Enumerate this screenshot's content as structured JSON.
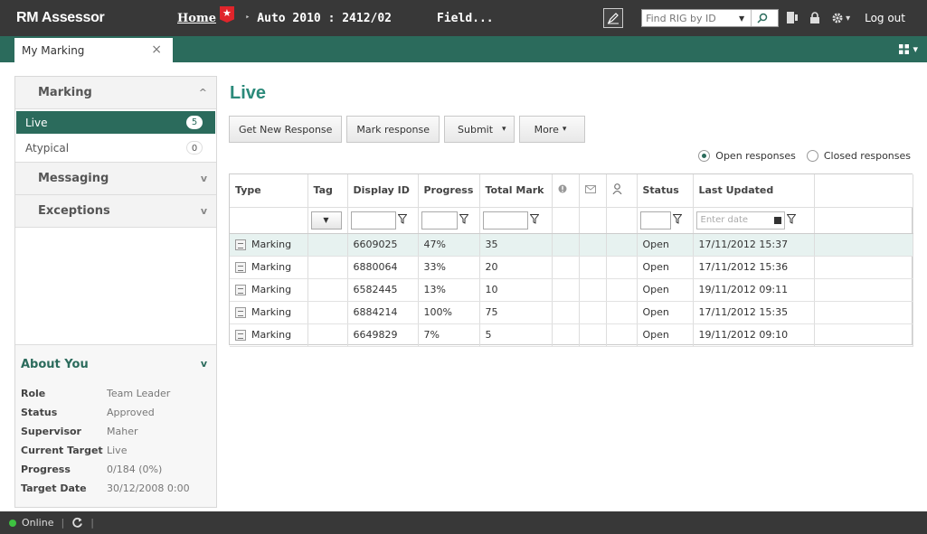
{
  "topbar": {
    "logo": "RM Assessor",
    "home_label": "Home",
    "home_badge": "★",
    "crumb_arrow": "‣",
    "crumb1": "Auto 2010 : 2412/02",
    "crumb2": "Field...",
    "find_placeholder": "Find RIG by ID",
    "find_dropdown": "▼",
    "settings_caret": "▾",
    "logout_label": "Log out"
  },
  "tabs": [
    {
      "label": "My Marking",
      "close": "×"
    }
  ],
  "grid_menu": {
    "caret": "▾"
  },
  "sidebar": {
    "marking": {
      "title": "Marking",
      "chevron": "^"
    },
    "items": [
      {
        "label": "Live",
        "count": "5"
      },
      {
        "label": "Atypical",
        "count": "0"
      }
    ],
    "messaging": {
      "title": "Messaging",
      "chevron": "v"
    },
    "exceptions": {
      "title": "Exceptions",
      "chevron": "v"
    },
    "about": {
      "title": "About You",
      "chevron": "v",
      "rows": [
        {
          "key": "Role",
          "value": "Team Leader"
        },
        {
          "key": "Status",
          "value": "Approved"
        },
        {
          "key": "Supervisor",
          "value": "Maher"
        },
        {
          "key": "Current Target",
          "value": "Live"
        },
        {
          "key": "Progress",
          "value": "0/184 (0%)"
        },
        {
          "key": "Target Date",
          "value": "30/12/2008 0:00"
        }
      ]
    }
  },
  "main": {
    "title": "Live",
    "buttons": {
      "get_new": "Get New Response",
      "mark": "Mark response",
      "submit": "Submit",
      "more": "More",
      "submit_caret": "▾",
      "more_caret": "▾"
    },
    "radios": {
      "open": "Open responses",
      "closed": "Closed responses",
      "selected": "open"
    },
    "table": {
      "headers": {
        "type": "Type",
        "tag": "Tag",
        "display_id": "Display ID",
        "progress": "Progress",
        "total_mark": "Total Mark",
        "status": "Status",
        "last_updated": "Last Updated"
      },
      "filter": {
        "tag_dropdown": "▼",
        "date_placeholder": "Enter date"
      },
      "rows": [
        {
          "type": "Marking",
          "tag": "",
          "display_id": "6609025",
          "progress": "47%",
          "total_mark": "35",
          "status": "Open",
          "last_updated": "17/11/2012 15:37"
        },
        {
          "type": "Marking",
          "tag": "",
          "display_id": "6880064",
          "progress": "33%",
          "total_mark": "20",
          "status": "Open",
          "last_updated": "17/11/2012 15:36"
        },
        {
          "type": "Marking",
          "tag": "",
          "display_id": "6582445",
          "progress": "13%",
          "total_mark": "10",
          "status": "Open",
          "last_updated": "19/11/2012 09:11"
        },
        {
          "type": "Marking",
          "tag": "",
          "display_id": "6884214",
          "progress": "100%",
          "total_mark": "75",
          "status": "Open",
          "last_updated": "17/11/2012 15:35"
        },
        {
          "type": "Marking",
          "tag": "",
          "display_id": "6649829",
          "progress": "7%",
          "total_mark": "5",
          "status": "Open",
          "last_updated": "19/11/2012 09:10"
        }
      ]
    }
  },
  "statusbar": {
    "online_label": "Online",
    "separator": "|"
  },
  "colors": {
    "topbar_bg": "#383838",
    "accent": "#2b6b5c",
    "title_teal": "#2b8a7a",
    "home_badge_red": "#e0252b",
    "online_green": "#3ec141"
  },
  "icons": {
    "pen": "pen-icon",
    "search": "search-icon",
    "mobile": "device-icon",
    "lock": "lock-icon",
    "settings": "gear-icon",
    "grid": "grid-icon",
    "refresh": "refresh-icon",
    "filter": "filter-icon",
    "flag": "flag-icon",
    "mail": "mail-icon",
    "person": "person-icon"
  }
}
